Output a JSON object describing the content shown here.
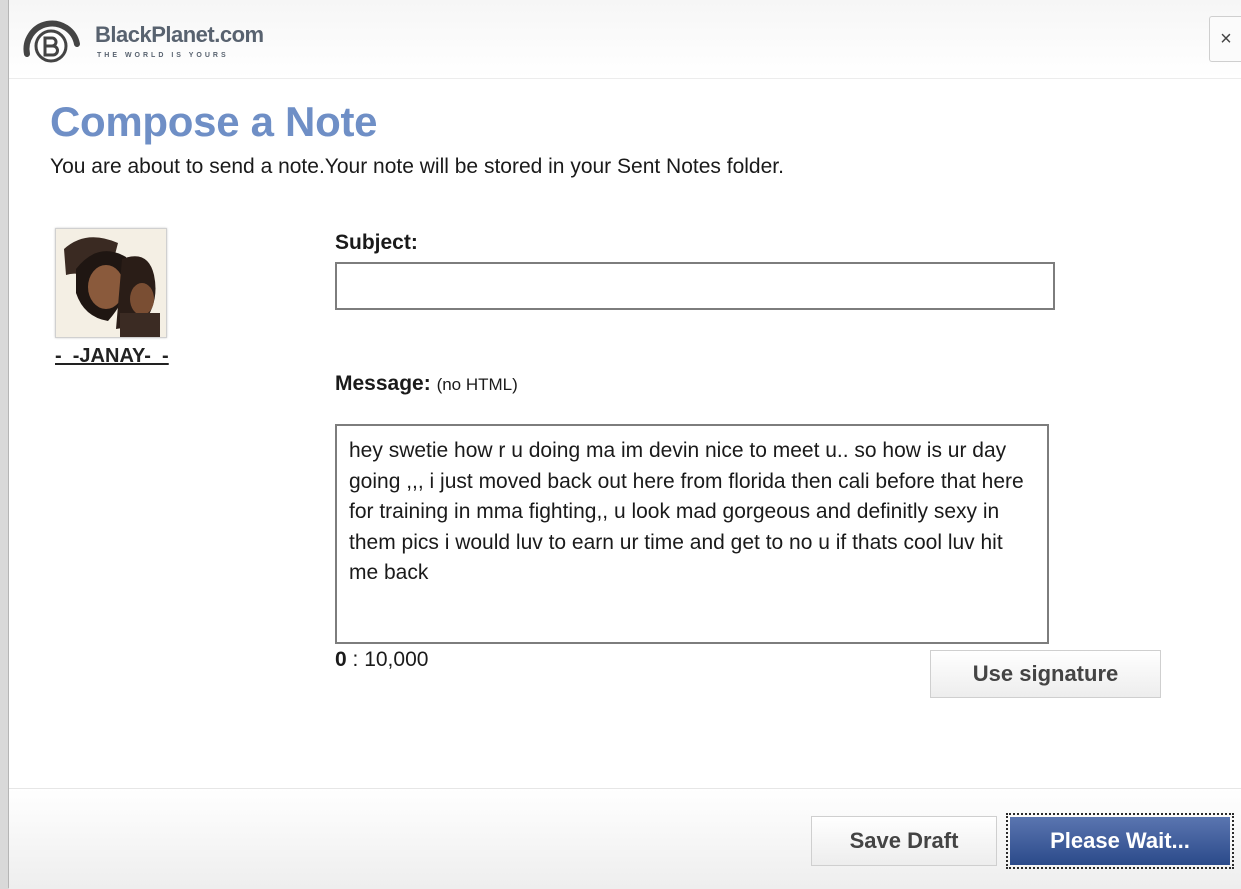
{
  "window": {
    "logo_text": "BlackPlanet.com",
    "logo_tagline": "THE WORLD IS YOURS",
    "close_label": "×"
  },
  "compose": {
    "title": "Compose a Note",
    "intro": "You are about to send a note.Your note will be stored in your Sent Notes folder."
  },
  "recipient": {
    "name": "-  -JANAY-  -"
  },
  "form": {
    "subject_label": "Subject:",
    "subject_value": "",
    "message_label": "Message:",
    "message_hint": "(no HTML)",
    "message_value": "hey swetie how r u doing ma im devin nice to meet u.. so how is ur day going ,,, i just moved back out here from florida then cali before that here for training in mma fighting,, u look mad gorgeous and definitly sexy in them pics i would luv to earn ur time and get to no u if thats cool luv hit me back",
    "counter_current": "0",
    "counter_max": " : 10,000",
    "signature_button": "Use signature"
  },
  "footer": {
    "save_draft_label": "Save Draft",
    "send_label": "Please Wait..."
  },
  "colors": {
    "heading": "#6f8fc6",
    "send_button": "#2b4a8a"
  }
}
